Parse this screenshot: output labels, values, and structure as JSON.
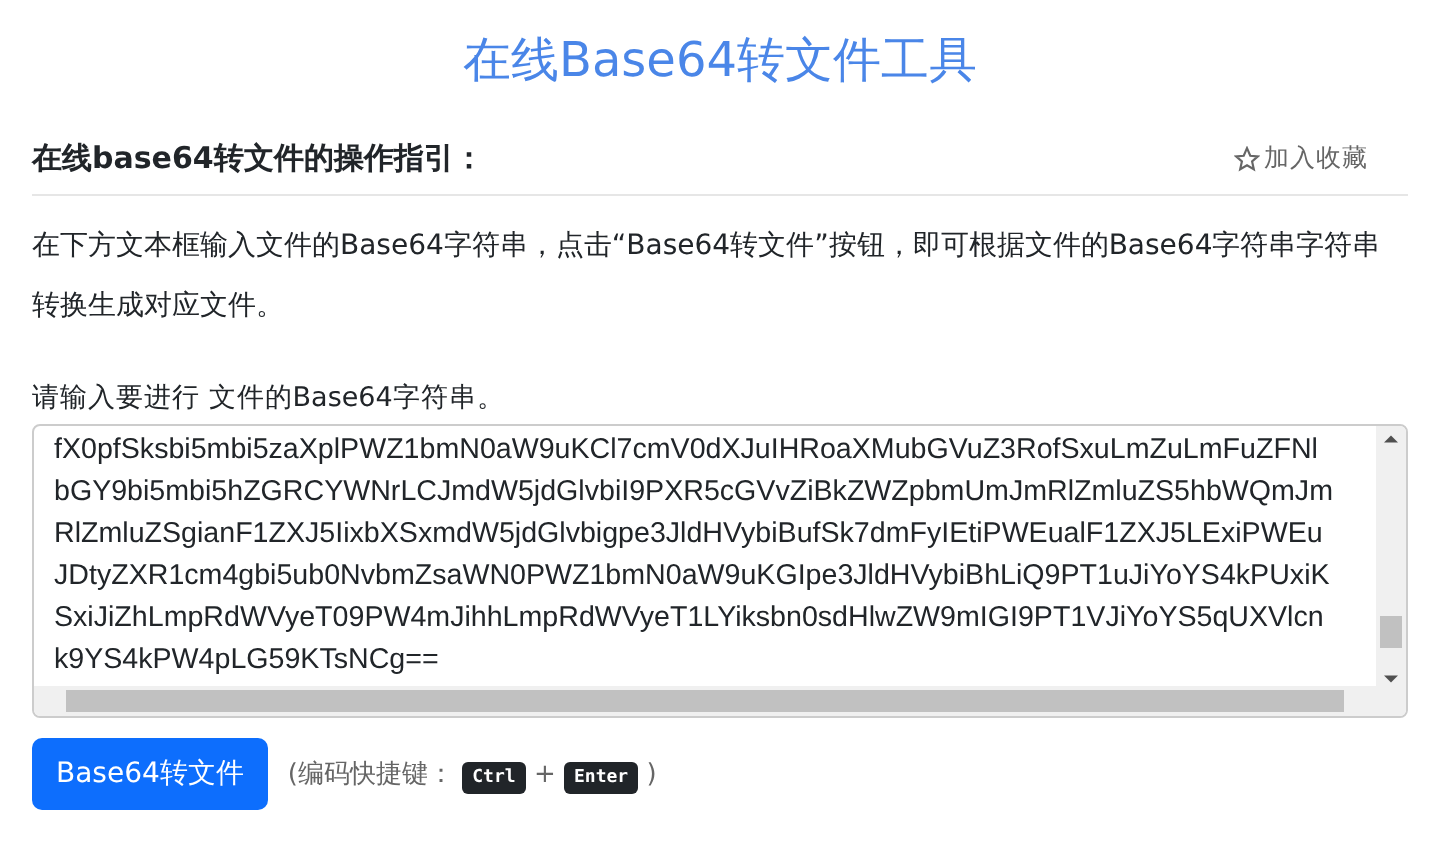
{
  "page_title": "在线Base64转文件工具",
  "guide": {
    "heading": "在线base64转文件的操作指引：",
    "bookmark": "加入收藏",
    "text": "在下方文本框输入文件的Base64字符串，点击“Base64转文件”按钮，即可根据文件的Base64字符串字符串转换生成对应文件。"
  },
  "input": {
    "label": "请输入要进行 文件的Base64字符串。",
    "value_lines": [
      "fX0pfSksbi5mbi5zaXplPWZ1bmN0aW9uKCl7cmV0dXJuIHRoaXMubGVuZ3RofSxuLmZuLmFuZFNl",
      "bGY9bi5mbi5hZGRCYWNrLCJmdW5jdGlvbiI9PXR5cGVvZiBkZWZpbmUmJmRlZmluZS5hbWQmJm",
      "RlZmluZSgianF1ZXJ5IixbXSxmdW5jdGlvbigpe3JldHVybiBufSk7dmFyIEtiPWEualF1ZXJ5LExiPWEu",
      "JDtyZXR1cm4gbi5ub0NvbmZsaWN0PWZ1bmN0aW9uKGIpe3JldHVybiBhLiQ9PT1uJiYoYS4kPUxiK",
      "SxiJiZhLmpRdWVyeT09PW4mJihhLmpRdWVyeT1LYiksbn0sdHlwZW9mIGI9PT1VJiYoYS5qUXVlcn",
      "k9YS4kPW4pLG59KTsNCg=="
    ]
  },
  "convert_button": "Base64转文件",
  "shortcut": {
    "prefix": "(编码快捷键：",
    "keys": [
      "Ctrl",
      "Enter"
    ],
    "joiner": "+",
    "suffix": ")"
  }
}
